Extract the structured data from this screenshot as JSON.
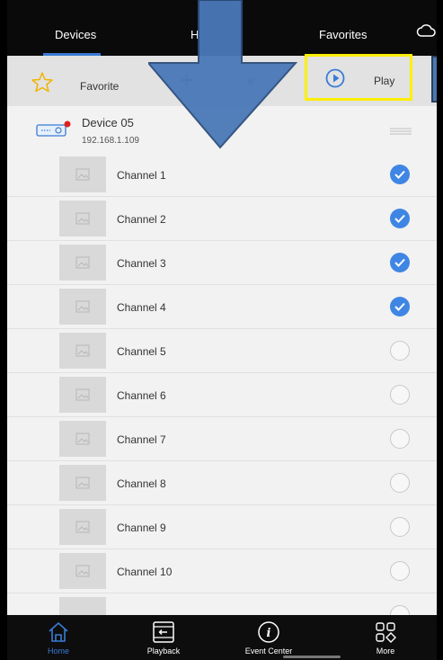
{
  "tabs": {
    "devices": "Devices",
    "hidden": "H",
    "favorites": "Favorites"
  },
  "toolbar": {
    "favorite_label": "Favorite",
    "add_label_fragment": "e",
    "play_label": "Play"
  },
  "device": {
    "name": "Device 05",
    "ip": "192.168.1.109"
  },
  "channels": [
    {
      "label": "Channel 1",
      "checked": true
    },
    {
      "label": "Channel 2",
      "checked": true
    },
    {
      "label": "Channel 3",
      "checked": true
    },
    {
      "label": "Channel 4",
      "checked": true
    },
    {
      "label": "Channel 5",
      "checked": false
    },
    {
      "label": "Channel 6",
      "checked": false
    },
    {
      "label": "Channel 7",
      "checked": false
    },
    {
      "label": "Channel 8",
      "checked": false
    },
    {
      "label": "Channel 9",
      "checked": false
    },
    {
      "label": "Channel 10",
      "checked": false
    }
  ],
  "bottom_nav": {
    "home": "Home",
    "playback": "Playback",
    "event_center": "Event Center",
    "more": "More"
  },
  "colors": {
    "accent_blue": "#3a7bd5",
    "check_blue": "#3f86e4",
    "highlight_yellow": "#ffee00",
    "arrow_blue": "#4a78b8"
  },
  "icons": {
    "cloud": "cloud-icon",
    "favorite": "star-icon",
    "add": "plus-icon",
    "play": "play-circle-icon",
    "device": "dvr-device-icon",
    "drag": "drag-handle-icon",
    "home": "home-icon",
    "playback": "film-playback-icon",
    "event_center": "info-icon",
    "more": "grid-more-icon"
  }
}
